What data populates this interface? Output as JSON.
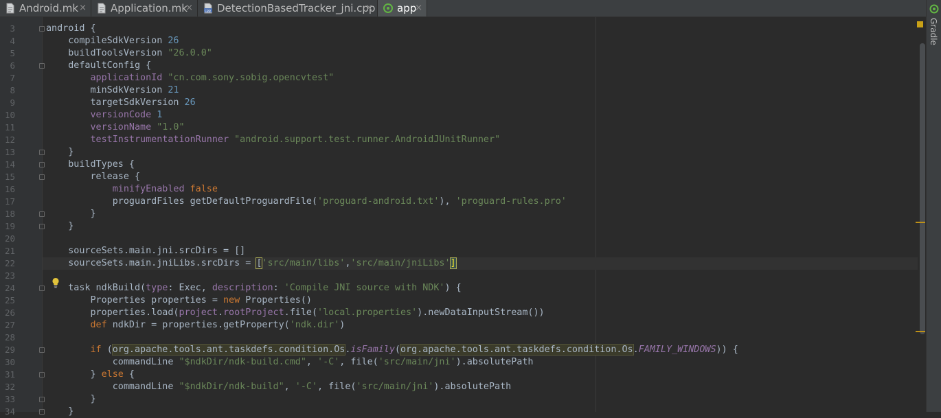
{
  "tabs": [
    {
      "name": "tab-android-mk",
      "label": "Android.mk",
      "icon": "file-icon",
      "active": false
    },
    {
      "name": "tab-application-mk",
      "label": "Application.mk",
      "icon": "file-icon",
      "active": false
    },
    {
      "name": "tab-detection-cpp",
      "label": "DetectionBasedTracker_jni.cpp",
      "icon": "cpp-file-icon",
      "active": false
    },
    {
      "name": "tab-app",
      "label": "app",
      "icon": "gradle-icon",
      "active": true
    }
  ],
  "close_glyph": "×",
  "sidebar": {
    "gradle_label": "Gradle"
  },
  "editor": {
    "line_numbers": [
      "3",
      "4",
      "5",
      "6",
      "7",
      "8",
      "9",
      "10",
      "11",
      "12",
      "13",
      "14",
      "15",
      "16",
      "17",
      "18",
      "19",
      "20",
      "21",
      "22",
      "23",
      "24",
      "25",
      "26",
      "27",
      "28",
      "29",
      "30",
      "31",
      "32",
      "33",
      "34"
    ],
    "current_line": "22",
    "lines": [
      "android {",
      "    compileSdkVersion 26",
      "    buildToolsVersion \"26.0.0\"",
      "    defaultConfig {",
      "        applicationId \"cn.com.sony.sobig.opencvtest\"",
      "        minSdkVersion 21",
      "        targetSdkVersion 26",
      "        versionCode 1",
      "        versionName \"1.0\"",
      "        testInstrumentationRunner \"android.support.test.runner.AndroidJUnitRunner\"",
      "    }",
      "    buildTypes {",
      "        release {",
      "            minifyEnabled false",
      "            proguardFiles getDefaultProguardFile('proguard-android.txt'), 'proguard-rules.pro'",
      "        }",
      "    }",
      "",
      "    sourceSets.main.jni.srcDirs = []",
      "    sourceSets.main.jniLibs.srcDirs = ['src/main/libs','src/main/jniLibs']",
      "",
      "    task ndkBuild(type: Exec, description: 'Compile JNI source with NDK') {",
      "        Properties properties = new Properties()",
      "        properties.load(project.rootProject.file('local.properties').newDataInputStream())",
      "        def ndkDir = properties.getProperty('ndk.dir')",
      "",
      "        if (org.apache.tools.ant.taskdefs.condition.Os.isFamily(org.apache.tools.ant.taskdefs.condition.Os.FAMILY_WINDOWS)) {",
      "            commandLine \"$ndkDir/ndk-build.cmd\", '-C', file('src/main/jni').absolutePath",
      "        } else {",
      "            commandLine \"$ndkDir/ndk-build\", '-C', file('src/main/jni').absolutePath",
      "        }",
      "    }"
    ]
  },
  "colors": {
    "background": "#2b2b2b",
    "gutter": "#313335",
    "default_text": "#a9b7c6",
    "string": "#6a8759",
    "number": "#6897bb",
    "keyword": "#cc7832",
    "property": "#9876aa",
    "line_number": "#606366",
    "warning": "#be9117"
  }
}
